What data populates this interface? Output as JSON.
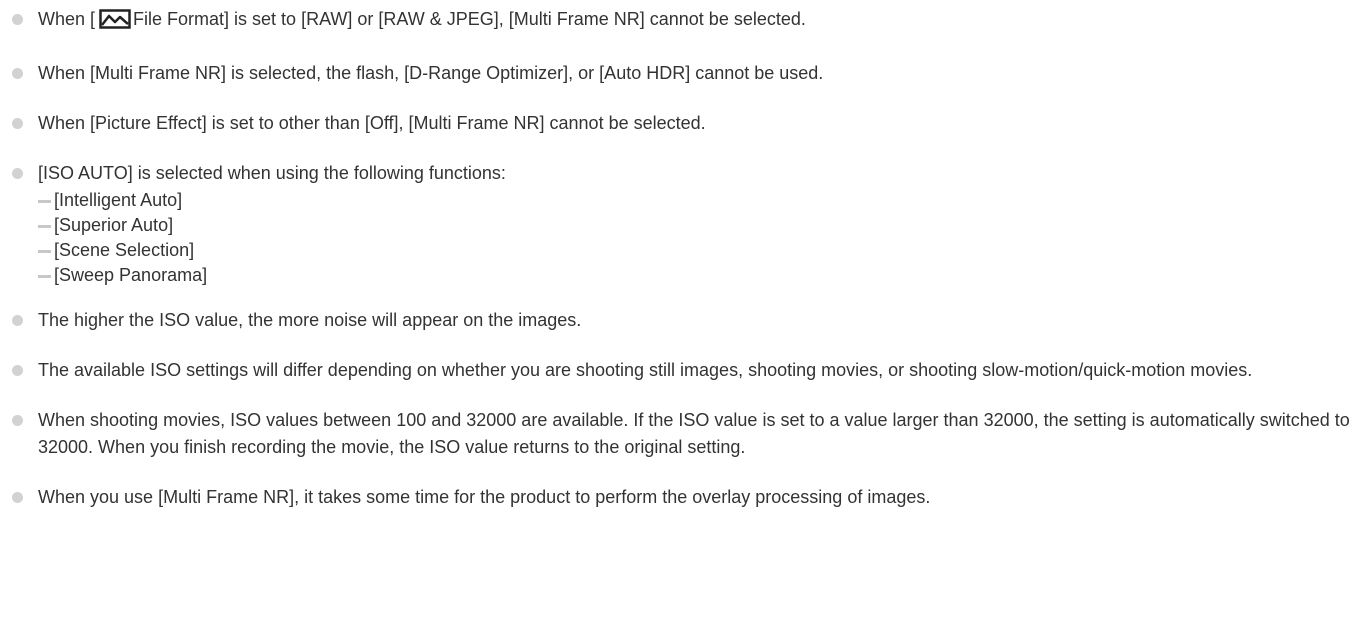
{
  "notes": [
    {
      "prefix": "When [",
      "icon": "still-image-icon",
      "suffix": "File Format] is set to [RAW] or [RAW & JPEG], [Multi Frame NR] cannot be selected."
    },
    {
      "text": "When [Multi Frame NR] is selected, the flash, [D-Range Optimizer], or [Auto HDR] cannot be used."
    },
    {
      "text": "When [Picture Effect] is set to other than [Off], [Multi Frame NR] cannot be selected."
    },
    {
      "text": "[ISO AUTO] is selected when using the following functions:",
      "sub_items": [
        "[Intelligent Auto]",
        "[Superior Auto]",
        "[Scene Selection]",
        "[Sweep Panorama]"
      ]
    },
    {
      "text": "The higher the ISO value, the more noise will appear on the images."
    },
    {
      "text": "The available ISO settings will differ depending on whether you are shooting still images, shooting movies, or shooting slow-motion/quick-motion movies."
    },
    {
      "text": "When shooting movies, ISO values between 100 and 32000 are available. If the ISO value is set to a value larger than 32000, the setting is automatically switched to 32000. When you finish recording the movie, the ISO value returns to the original setting."
    },
    {
      "text": "When you use [Multi Frame NR], it takes some time for the product to perform the overlay processing of images."
    }
  ]
}
